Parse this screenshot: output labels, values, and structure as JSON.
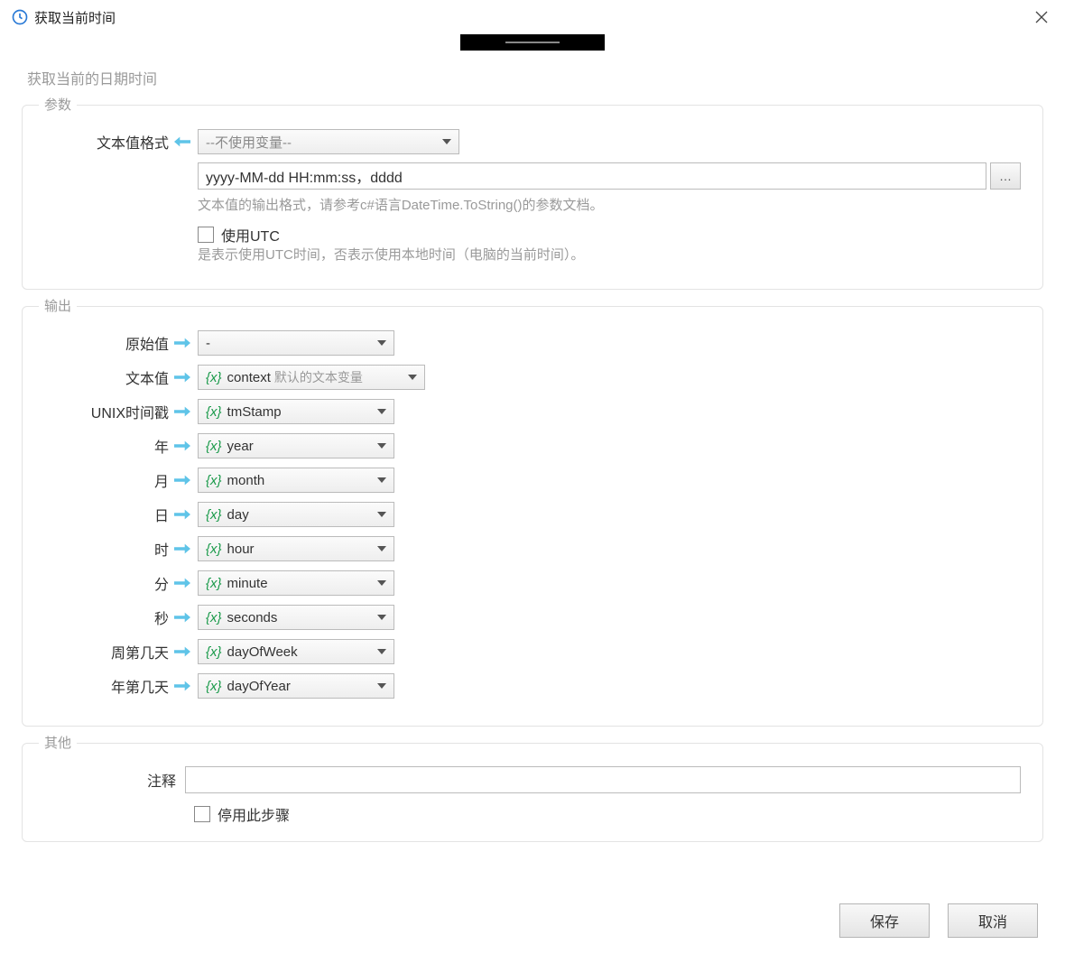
{
  "header": {
    "title": "获取当前时间"
  },
  "subtitle": "获取当前的日期时间",
  "panels": {
    "params": {
      "legend": "参数",
      "format_label": "文本值格式",
      "format_var_dropdown": "--不使用变量--",
      "format_value": "yyyy-MM-dd HH:mm:ss，dddd",
      "format_help": "文本值的输出格式，请参考c#语言DateTime.ToString()的参数文档。",
      "use_utc_label": "使用UTC",
      "use_utc_help": "是表示使用UTC时间，否表示使用本地时间（电脑的当前时间）。"
    },
    "output": {
      "legend": "输出",
      "rows": [
        {
          "label": "原始值",
          "var": "-",
          "hint": "",
          "show_x": false
        },
        {
          "label": "文本值",
          "var": "context",
          "hint": "默认的文本变量",
          "show_x": true,
          "wider": true
        },
        {
          "label": "UNIX时间戳",
          "var": "tmStamp",
          "hint": "",
          "show_x": true
        },
        {
          "label": "年",
          "var": "year",
          "hint": "",
          "show_x": true
        },
        {
          "label": "月",
          "var": "month",
          "hint": "",
          "show_x": true
        },
        {
          "label": "日",
          "var": "day",
          "hint": "",
          "show_x": true
        },
        {
          "label": "时",
          "var": "hour",
          "hint": "",
          "show_x": true
        },
        {
          "label": "分",
          "var": "minute",
          "hint": "",
          "show_x": true
        },
        {
          "label": "秒",
          "var": "seconds",
          "hint": "",
          "show_x": true
        },
        {
          "label": "周第几天",
          "var": "dayOfWeek",
          "hint": "",
          "show_x": true
        },
        {
          "label": "年第几天",
          "var": "dayOfYear",
          "hint": "",
          "show_x": true
        }
      ]
    },
    "other": {
      "legend": "其他",
      "comment_label": "注释",
      "comment_value": "",
      "disable_label": "停用此步骤"
    }
  },
  "footer": {
    "save": "保存",
    "cancel": "取消"
  }
}
